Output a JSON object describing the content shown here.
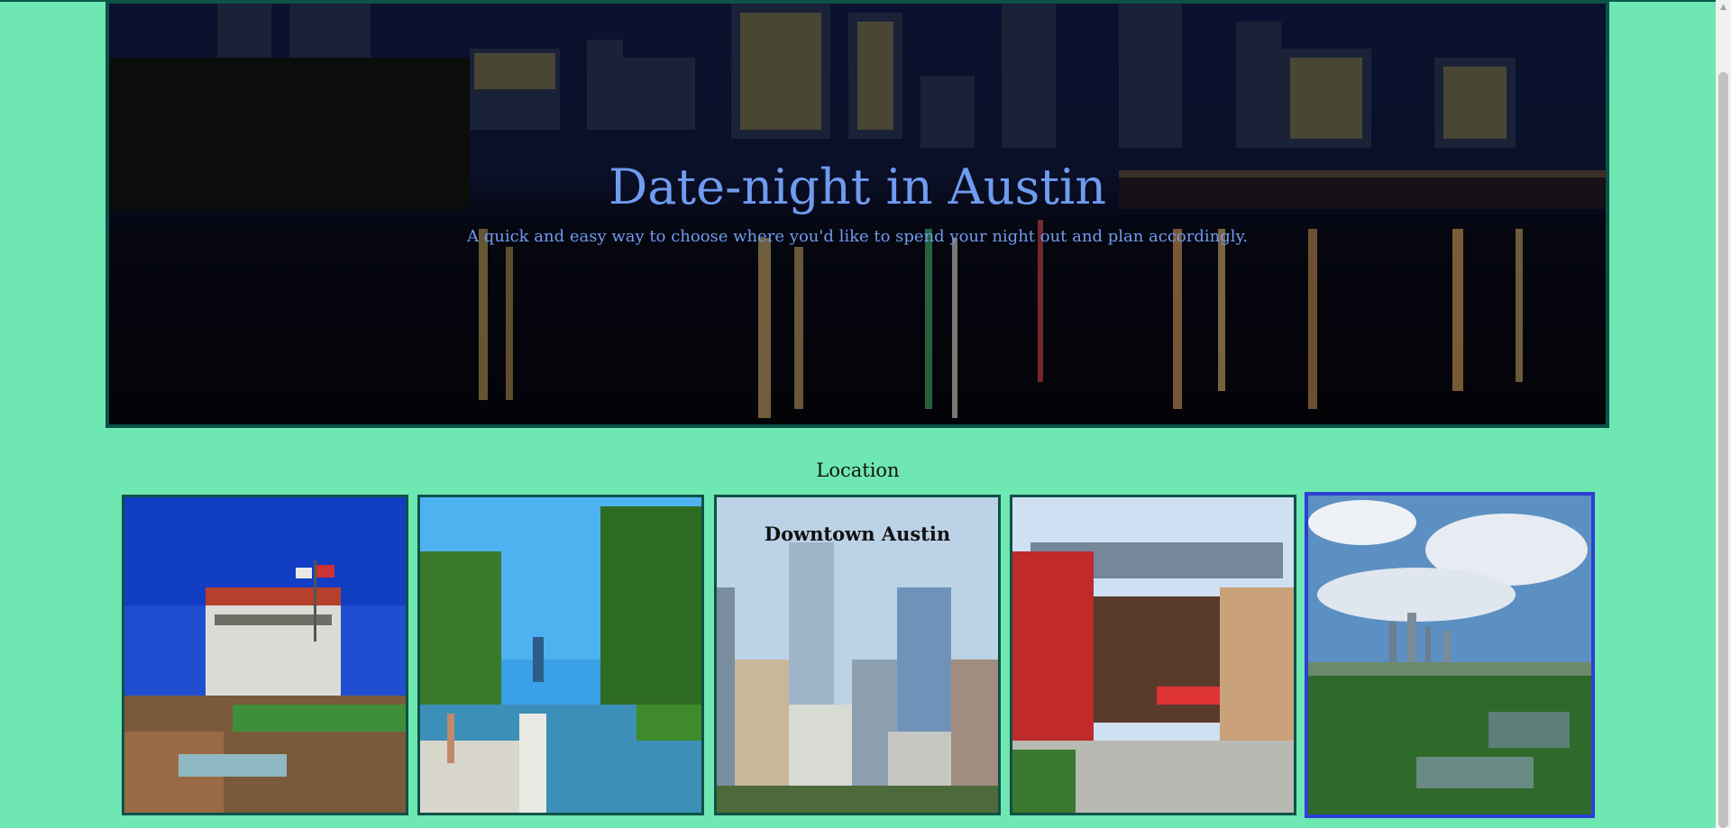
{
  "hero": {
    "title": "Date-night in Austin",
    "subtitle": "A quick and easy way to choose where you'd like to spend your night out and plan accordingly."
  },
  "section": {
    "title": "Location"
  },
  "locations": [
    {
      "name": "",
      "image": "hill-country-waterfall-building-photo"
    },
    {
      "name": "",
      "image": "barton-springs-pool-photo"
    },
    {
      "name": "Downtown Austin",
      "image": "downtown-skyscrapers-photo"
    },
    {
      "name": "",
      "image": "covered-street-market-photo"
    },
    {
      "name": "",
      "image": "austin-skyline-aerial-photo",
      "selected": true
    }
  ],
  "colors": {
    "page_bg": "#6ee7b2",
    "frame_border": "#0d5247",
    "title_blue": "#6f9bf0",
    "selected_border": "#2d3fd6"
  }
}
